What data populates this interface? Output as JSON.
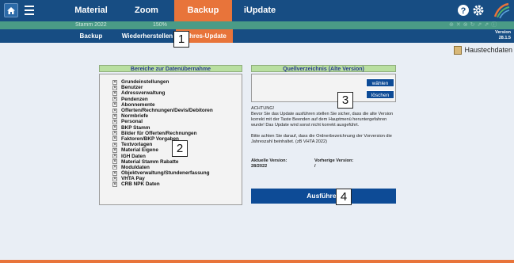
{
  "nav": {
    "tabs": [
      {
        "label": "Material",
        "active": false
      },
      {
        "label": "Zoom",
        "active": false
      },
      {
        "label": "Backup",
        "active": true
      },
      {
        "label": "iUpdate",
        "active": false
      }
    ]
  },
  "strip": {
    "left_text": "Stamm 2022",
    "zoom_text": "150%"
  },
  "submenu": {
    "items": [
      {
        "label": "Backup",
        "active": false
      },
      {
        "label": "Wiederherstellen",
        "active": false
      },
      {
        "label": "Jahres-Update",
        "active": true
      }
    ],
    "version_label": "Version",
    "version_value": "28.1.5"
  },
  "user": {
    "name": "Haustechdaten"
  },
  "left_panel": {
    "title": "Bereiche zur Datenübernahme",
    "check_mark": "✕",
    "items": [
      "Grundeinstellungen",
      "Benutzer",
      "Adressverwaltung",
      "Pendenzen",
      "Abonnemente",
      "Offerten/Rechnungen/Devis/Debitoren",
      "Normbriefe",
      "Personal",
      "BKP Stamm",
      "Bilder für Offerten/Rechnungen",
      "Faktoren/BKP Vorgaben",
      "Textvorlagen",
      "Material Eigene",
      "IGH Daten",
      "Material Stamm Rabatte",
      "Moduldaten",
      "Objektverwaltung/Stundenerfassung",
      "VHTA Pay",
      "CRB NPK Daten"
    ]
  },
  "right_panel": {
    "title": "Quellverzeichnis (Alte Version)",
    "choose_button": "wählen",
    "delete_button": "löschen",
    "warning_title": "ACHTUNG!",
    "warning_text": "Bevor Sie das Update ausführen stellen Sie sicher, dass die alte Version korrekt mit der Taste Beenden auf dem Hauptmenü heruntergefahren wurde! Das Update wird sonst nicht korrekt ausgeführt.",
    "hint_text": "Bitte achten Sie darauf, dass die Ordnerbezeichnung der Vorversion die Jahreszahl beinhaltet. (zB VHTA 2022)",
    "current_version_label": "Aktuelle Version:",
    "current_version_value": "28/2022",
    "previous_version_label": "Vorherige Version:",
    "previous_version_value": "/",
    "execute_button": "Ausführen"
  },
  "callouts": [
    "1",
    "2",
    "3",
    "4"
  ],
  "icons": [
    "home-icon",
    "list-icon",
    "help-icon",
    "gear-icon",
    "logo-icon"
  ],
  "colors": {
    "nav": "#174d83",
    "active": "#e8743a",
    "strip": "#4a9b86",
    "button": "#0d4b96",
    "panel_head": "#b9dfa0"
  }
}
